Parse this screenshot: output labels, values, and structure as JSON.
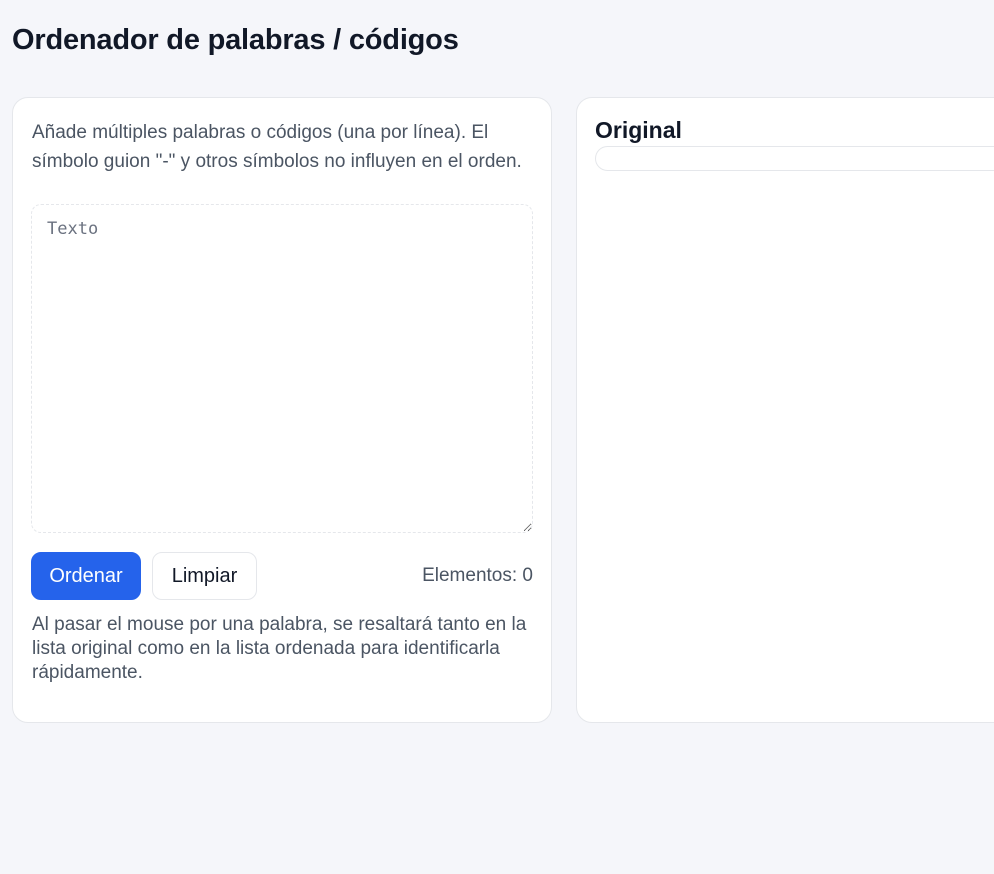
{
  "page": {
    "title": "Ordenador de palabras / códigos"
  },
  "input_panel": {
    "instructions": "Añade múltiples palabras o códigos (una por línea). El símbolo guion \"-\" y otros símbolos no influyen en el orden.",
    "textarea": {
      "placeholder": "Texto",
      "value": ""
    },
    "sort_button_label": "Ordenar",
    "clear_button_label": "Limpiar",
    "count_text": "Elementos: 0",
    "hint": "Al pasar el mouse por una palabra, se resaltará tanto en la lista original como en la lista ordenada para identificarla rápidamente."
  },
  "original_panel": {
    "title": "Original",
    "items": []
  },
  "colors": {
    "background": "#f5f6fa",
    "card": "#ffffff",
    "border": "#e5e7eb",
    "primary": "#2563eb",
    "text": "#111827",
    "muted_text": "#4b5563"
  }
}
